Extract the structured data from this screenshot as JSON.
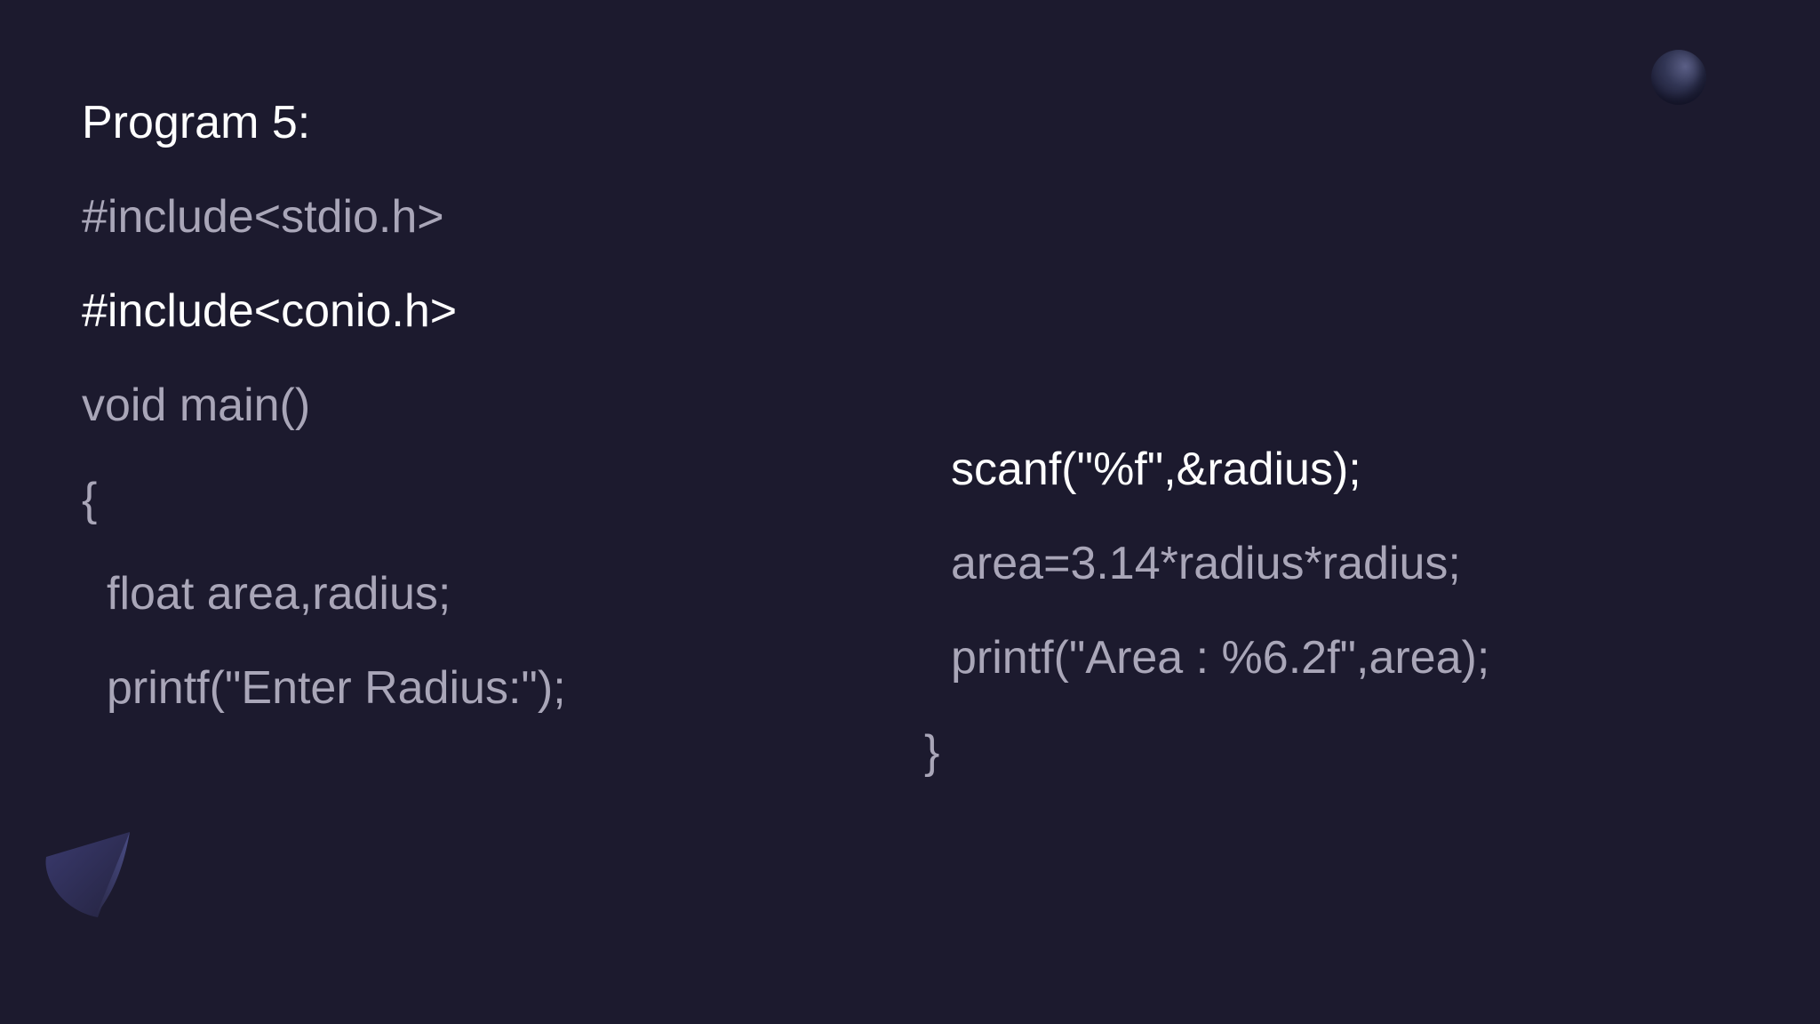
{
  "slide": {
    "title": "Program 5:",
    "left_code": [
      "#include<stdio.h>",
      "#include<conio.h>",
      "void main()",
      "{",
      "float area,radius;",
      "printf(\"Enter Radius:\");"
    ],
    "right_code": [
      "scanf(\"%f\",&radius);",
      "area=3.14*radius*radius;",
      "printf(\"Area : %6.2f\",area);",
      "}"
    ]
  },
  "decorations": {
    "sphere": "sphere-icon",
    "cone": "cone-icon"
  },
  "colors": {
    "background": "#1c1a2e",
    "text_dim": "#a9a6b8",
    "text_bright": "#ffffff"
  }
}
